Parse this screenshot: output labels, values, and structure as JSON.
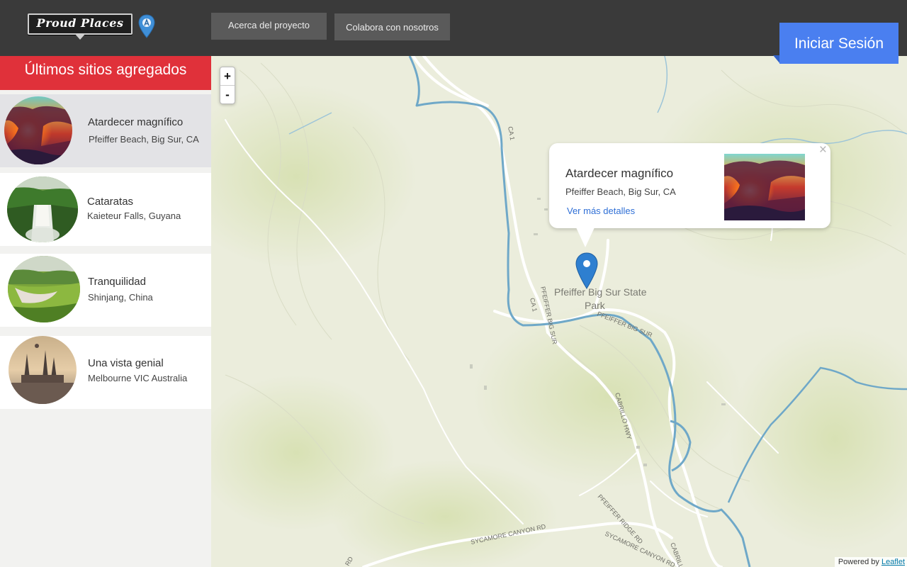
{
  "header": {
    "logo_text": "Proud Places",
    "nav": {
      "about_label": "Acerca del proyecto",
      "collab_label": "Colabora con nosotros"
    },
    "login_label": "Iniciar Sesión"
  },
  "sidebar": {
    "title": "Últimos sitios agregados",
    "items": [
      {
        "name": "Atardecer magnífico",
        "place": "Pfeiffer Beach, Big Sur, CA",
        "selected": true
      },
      {
        "name": "Cataratas",
        "place": "Kaieteur Falls, Guyana",
        "selected": false
      },
      {
        "name": "Tranquilidad",
        "place": "Shinjang, China",
        "selected": false
      },
      {
        "name": "Una vista genial",
        "place": "Melbourne VIC Australia",
        "selected": false
      }
    ]
  },
  "map": {
    "zoom_in": "+",
    "zoom_out": "-",
    "labels": {
      "park_line1": "Pfeiffer Big Sur State",
      "park_line2": "Park",
      "ca1_north": "CA 1",
      "ca1_south": "CA 1",
      "pfeiffer_big_sur_a": "PFEIFFER BIG SUR",
      "pfeiffer_big_sur_b": "PFEIFFER BIG SUR",
      "cabrillo_hwy": "CABRILLO HWY",
      "cabrillo_short": "CABRILL",
      "pfeiffer_ridge": "PFEIFFER RIDGE RD",
      "sycamore_a": "SYCAMORE CANYON RD",
      "sycamore_b": "SYCAMORE CANYON RD",
      "rd_corner": "RD"
    },
    "popup": {
      "title": "Atardecer magnífico",
      "place": "Pfeiffer Beach, Big Sur, CA",
      "link": "Ver más detalles",
      "close": "×"
    },
    "attribution_prefix": "Powered by",
    "attribution_link": "Leaflet"
  },
  "colors": {
    "topbar": "#3a3a3a",
    "nav_button": "#5a5a5a",
    "login_button": "#4a7ff0",
    "sidebar_title": "#e0313a",
    "selected_item": "#e3e3e6",
    "map_base": "#ebeddc",
    "river": "#6fa8c8",
    "marker": "#2e7fd0",
    "link": "#2f6fd6"
  },
  "icons": {
    "logo_pin": "map-pin-icon",
    "marker": "map-marker-icon",
    "close": "close-icon"
  }
}
